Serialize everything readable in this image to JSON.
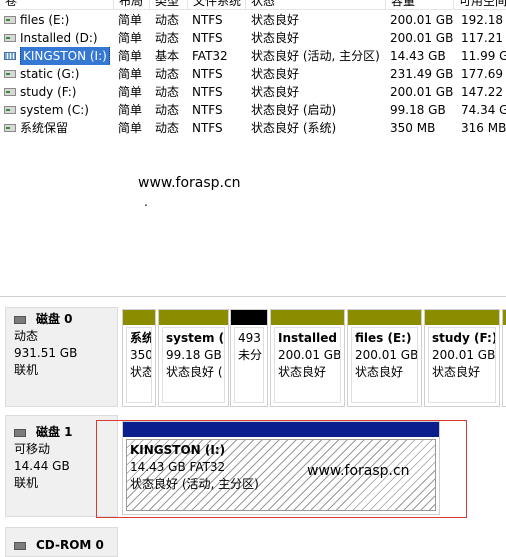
{
  "volume_list": {
    "headers": [
      "卷",
      "布局",
      "类型",
      "文件系统",
      "状态",
      "容量",
      "可用空间"
    ],
    "rows": [
      {
        "name": "files (E:)",
        "layout": "简单",
        "type": "动态",
        "fs": "NTFS",
        "status": "状态良好",
        "capacity": "200.01 GB",
        "free": "192.18 G",
        "icon": "drive-icon"
      },
      {
        "name": "Installed (D:)",
        "layout": "简单",
        "type": "动态",
        "fs": "NTFS",
        "status": "状态良好",
        "capacity": "200.01 GB",
        "free": "117.21 G",
        "icon": "drive-icon"
      },
      {
        "name": "KINGSTON (I:)",
        "layout": "简单",
        "type": "基本",
        "fs": "FAT32",
        "status": "状态良好 (活动, 主分区)",
        "capacity": "14.43 GB",
        "free": "11.99 G",
        "icon": "usb-drive-icon",
        "selected": true
      },
      {
        "name": "static (G:)",
        "layout": "简单",
        "type": "动态",
        "fs": "NTFS",
        "status": "状态良好",
        "capacity": "231.49 GB",
        "free": "177.69 G",
        "icon": "drive-icon"
      },
      {
        "name": "study (F:)",
        "layout": "简单",
        "type": "动态",
        "fs": "NTFS",
        "status": "状态良好",
        "capacity": "200.01 GB",
        "free": "147.22 G",
        "icon": "drive-icon"
      },
      {
        "name": "system (C:)",
        "layout": "简单",
        "type": "动态",
        "fs": "NTFS",
        "status": "状态良好 (启动)",
        "capacity": "99.18 GB",
        "free": "74.34 G",
        "icon": "drive-icon"
      },
      {
        "name": "系统保留",
        "layout": "简单",
        "type": "动态",
        "fs": "NTFS",
        "status": "状态良好 (系统)",
        "capacity": "350 MB",
        "free": "316 MB",
        "icon": "drive-icon"
      }
    ],
    "watermark": "www.forasp.cn",
    "dot": "."
  },
  "disks": [
    {
      "title": "磁盘 0",
      "type": "动态",
      "size": "931.51 GB",
      "state": "联机",
      "partitions": [
        {
          "name": "系统",
          "size": "350",
          "status": "状态良好"
        },
        {
          "name": "system (",
          "size": "99.18 GB",
          "status": "状态良好 ("
        },
        {
          "name": "",
          "size": "493",
          "status": "未分"
        },
        {
          "name": "Installed",
          "size": "200.01 GB",
          "status": "状态良好"
        },
        {
          "name": "files  (E:)",
          "size": "200.01 GB",
          "status": "状态良好"
        },
        {
          "name": "study   (F:)",
          "size": "200.01 GB",
          "status": "状态良好"
        },
        {
          "name": "",
          "size": "",
          "status": ""
        }
      ]
    },
    {
      "title": "磁盘 1",
      "type": "可移动",
      "size": "14.44 GB",
      "state": "联机",
      "partitions": [
        {
          "name": "KINGSTON   (I:)",
          "size": "14.43 GB FAT32",
          "status": "状态良好 (活动, 主分区)"
        }
      ],
      "watermark": "www.forasp.cn"
    },
    {
      "title": "CD-ROM 0"
    }
  ],
  "colors": {
    "dynamic_bar": "#8c8c00",
    "unallocated_bar": "#000000",
    "primary_bar": "#0a1e8c",
    "selection": "#3478d4",
    "highlight_box": "#d83a3a"
  }
}
